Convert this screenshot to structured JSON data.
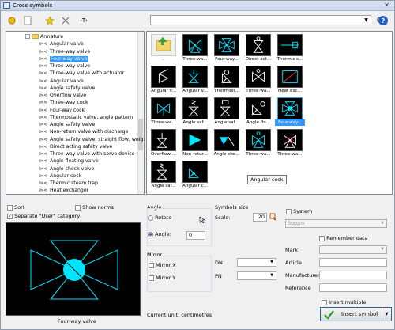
{
  "window": {
    "title": "Cross symbols",
    "close": "✕"
  },
  "toolbar": {
    "buttons": [
      "add-symbol",
      "new-folder",
      "favorite",
      "delete",
      "text-tag"
    ],
    "text_tag_label": "‹T›",
    "search_value": "",
    "help": "?"
  },
  "tree": {
    "items": [
      {
        "label": "Armature",
        "type": "folder"
      },
      {
        "label": "Angular valve"
      },
      {
        "label": "Three-way valve"
      },
      {
        "label": "Four-way valve",
        "selected": true
      },
      {
        "label": "Three-way valve"
      },
      {
        "label": "Three-way valve with actuator"
      },
      {
        "label": "Angular valve"
      },
      {
        "label": "Angle safety valve"
      },
      {
        "label": "Overflow valve"
      },
      {
        "label": "Three-way cock"
      },
      {
        "label": "Four-way cock"
      },
      {
        "label": "Thermostatic valve, angle pattern"
      },
      {
        "label": "Angle safety valve"
      },
      {
        "label": "Non-return valve with discharge"
      },
      {
        "label": "Angle safety valve, straight flow, weight a"
      },
      {
        "label": "Direct acting safety valve"
      },
      {
        "label": "Three-way valve with servo device"
      },
      {
        "label": "Angle floating valve"
      },
      {
        "label": "Angle check valve"
      },
      {
        "label": "Angular cock"
      },
      {
        "label": "Thermic steam trap"
      },
      {
        "label": "Heat exchanger"
      }
    ]
  },
  "grid": {
    "cells": [
      {
        "label": ".."
      },
      {
        "label": "Three-wa..."
      },
      {
        "label": "Four-way..."
      },
      {
        "label": "Direct act..."
      },
      {
        "label": "Thermic s..."
      },
      {
        "label": "Angular v..."
      },
      {
        "label": "Angular v..."
      },
      {
        "label": "Thermost..."
      },
      {
        "label": "Three-wa..."
      },
      {
        "label": "Heat exc..."
      },
      {
        "label": "Three-wa..."
      },
      {
        "label": "Angle saf..."
      },
      {
        "label": "Angle saf..."
      },
      {
        "label": "Angle flo..."
      },
      {
        "label": "Four-way...",
        "selected": true
      },
      {
        "label": "Overflow ..."
      },
      {
        "label": "Non-retur..."
      },
      {
        "label": "Angle che..."
      },
      {
        "label": "Three-wa..."
      },
      {
        "label": "Three-wa..."
      },
      {
        "label": "Angle saf..."
      },
      {
        "label": "Angular c..."
      }
    ],
    "tooltip": "Angular cock"
  },
  "options": {
    "sort": "Sort",
    "show_norms": "Show norms",
    "separate_user": "Separate \"User\" category",
    "preview_caption": "Four-way valve"
  },
  "angle": {
    "title": "Angle",
    "rotate": "Rotate",
    "angle_label": "Angle:",
    "angle_value": "0"
  },
  "mirror": {
    "title": "Mirror",
    "x": "Mirror X",
    "y": "Mirror Y"
  },
  "symbol_size": {
    "title": "Symbols size",
    "scale_label": "Scale:",
    "scale_value": "20"
  },
  "dn_label": "DN",
  "pn_label": "PN",
  "current_unit": "Current unit: centimetres",
  "system": {
    "label": "System",
    "supply": "Supply"
  },
  "remember_data": "Remember data",
  "fields": {
    "mark": "Mark",
    "article": "Article",
    "manufacturer": "Manufacturer",
    "reference": "Reference"
  },
  "insert_multiple": "Insert multiple",
  "insert_symbol": "Insert symbol",
  "colors": {
    "accent": "#3399ff",
    "symbol": "#00e5ff"
  }
}
